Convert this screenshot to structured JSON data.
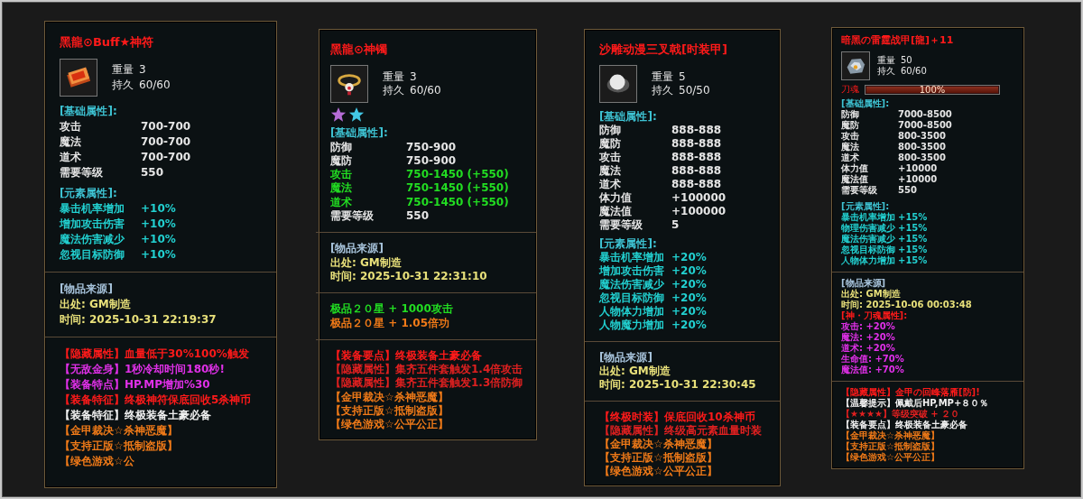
{
  "panels": [
    {
      "title": "黑龍⊙Buff★神符",
      "weight": {
        "label": "重量",
        "value": "3"
      },
      "durability": {
        "label": "持久",
        "value": "60/60"
      },
      "sections": [
        [
          {
            "kind": "heading",
            "text": "[基础属性]:",
            "color": "#3ec3d3"
          },
          {
            "kind": "stat",
            "label": "攻击",
            "value": "700-700",
            "color": "#e6e6e6"
          },
          {
            "kind": "stat",
            "label": "魔法",
            "value": "700-700",
            "color": "#e6e6e6"
          },
          {
            "kind": "stat",
            "label": "道术",
            "value": "700-700",
            "color": "#e6e6e6"
          },
          {
            "kind": "stat",
            "label": "需要等级",
            "value": "550",
            "color": "#e6e6e6"
          },
          {
            "kind": "heading",
            "text": "[元素属性]:",
            "color": "#3ec3d3"
          },
          {
            "kind": "stat",
            "label": "暴击机率增加",
            "value": "+10%",
            "color": "#22d0d0"
          },
          {
            "kind": "stat",
            "label": "增加攻击伤害",
            "value": "+10%",
            "color": "#22d0d0"
          },
          {
            "kind": "stat",
            "label": "魔法伤害减少",
            "value": "+10%",
            "color": "#22d0d0"
          },
          {
            "kind": "stat",
            "label": "忽视目标防御",
            "value": "+10%",
            "color": "#22d0d0"
          }
        ],
        [
          {
            "kind": "text",
            "text": "[物品来源]",
            "color": "#a8c4dc"
          },
          {
            "kind": "text",
            "text": "出处: GM制造",
            "color": "#e8e07a"
          },
          {
            "kind": "text",
            "text": "时间: 2025-10-31 22:19:37",
            "color": "#e8e07a"
          }
        ],
        [
          {
            "kind": "text",
            "text": "【隐藏属性】血量低于30%100%触发",
            "color": "#ff1a1a"
          },
          {
            "kind": "text",
            "text": "【无敌金身】1秒冷却时间180秒!",
            "color": "#e030e8"
          },
          {
            "kind": "text",
            "text": "【装备特点】HP.MP增加%30",
            "color": "#e030e8"
          },
          {
            "kind": "text",
            "text": "【装备特征】终极神符保底回收5杀神币",
            "color": "#ff1a1a"
          },
          {
            "kind": "text",
            "text": "【装备特征】终极装备土豪必备",
            "color": "#f0f0f0"
          },
          {
            "kind": "text",
            "text": "【金甲裁决☆杀神恶魔】",
            "color": "#f07a18"
          },
          {
            "kind": "text",
            "text": "【支持正版☆抵制盗版】",
            "color": "#f07a18"
          },
          {
            "kind": "text",
            "text": "【绿色游戏☆公",
            "color": "#f07a18"
          }
        ]
      ]
    },
    {
      "title": "黑龍⊙神镯",
      "weight": {
        "label": "重量",
        "value": "3"
      },
      "durability": {
        "label": "持久",
        "value": "60/60"
      },
      "gems": [
        {
          "color": "#b56cd6"
        },
        {
          "color": "#42c8e6"
        }
      ],
      "sections": [
        [
          {
            "kind": "heading",
            "text": "[基础属性]:",
            "color": "#3ec3d3"
          },
          {
            "kind": "stat",
            "label": "防御",
            "value": "750-900",
            "color": "#e6e6e6"
          },
          {
            "kind": "stat",
            "label": "魔防",
            "value": "750-900",
            "color": "#e6e6e6"
          },
          {
            "kind": "stat",
            "label": "攻击",
            "value": "750-1450 (+550)",
            "color": "#22dd22"
          },
          {
            "kind": "stat",
            "label": "魔法",
            "value": "750-1450 (+550)",
            "color": "#22dd22"
          },
          {
            "kind": "stat",
            "label": "道术",
            "value": "750-1450 (+550)",
            "color": "#22dd22"
          },
          {
            "kind": "stat",
            "label": "需要等级",
            "value": "550",
            "color": "#e6e6e6"
          }
        ],
        [
          {
            "kind": "text",
            "text": "[物品来源]",
            "color": "#a8c4dc"
          },
          {
            "kind": "text",
            "text": "出处: GM制造",
            "color": "#e8e07a"
          },
          {
            "kind": "text",
            "text": "时间: 2025-10-31 22:31:10",
            "color": "#e8e07a"
          }
        ],
        [
          {
            "kind": "text",
            "text": "极品２０星 + 1000攻击",
            "color": "#22dd22"
          },
          {
            "kind": "text",
            "text": "极品２０星 + 1.05倍功",
            "color": "#f07a18"
          }
        ],
        [
          {
            "kind": "text",
            "text": "【装备要点】终极装备土豪必备",
            "color": "#ff1a1a"
          },
          {
            "kind": "text",
            "text": "【隐藏属性】集齐五件套触发1.4倍攻击",
            "color": "#e02020"
          },
          {
            "kind": "text",
            "text": "【隐藏属性】集齐五件套触发1.3倍防御",
            "color": "#e02020"
          },
          {
            "kind": "text",
            "text": "【金甲裁决☆杀神恶魔】",
            "color": "#f07a18"
          },
          {
            "kind": "text",
            "text": "【支持正版☆抵制盗版】",
            "color": "#f07a18"
          },
          {
            "kind": "text",
            "text": "【绿色游戏☆公平公正】",
            "color": "#f07a18"
          }
        ]
      ]
    },
    {
      "title": "沙雕动漫三叉戟[时装甲]",
      "weight": {
        "label": "重量",
        "value": "5"
      },
      "durability": {
        "label": "持久",
        "value": "50/50"
      },
      "sections": [
        [
          {
            "kind": "heading",
            "text": "[基础属性]:",
            "color": "#3ec3d3"
          },
          {
            "kind": "stat",
            "label": "防御",
            "value": "888-888",
            "color": "#e6e6e6"
          },
          {
            "kind": "stat",
            "label": "魔防",
            "value": "888-888",
            "color": "#e6e6e6"
          },
          {
            "kind": "stat",
            "label": "攻击",
            "value": "888-888",
            "color": "#e6e6e6"
          },
          {
            "kind": "stat",
            "label": "魔法",
            "value": "888-888",
            "color": "#e6e6e6"
          },
          {
            "kind": "stat",
            "label": "道术",
            "value": "888-888",
            "color": "#e6e6e6"
          },
          {
            "kind": "stat",
            "label": "体力值",
            "value": "+100000",
            "color": "#e6e6e6"
          },
          {
            "kind": "stat",
            "label": "魔法值",
            "value": "+100000",
            "color": "#e6e6e6"
          },
          {
            "kind": "stat",
            "label": "需要等级",
            "value": "5",
            "color": "#e6e6e6"
          },
          {
            "kind": "heading",
            "text": "[元素属性]:",
            "color": "#3ec3d3"
          },
          {
            "kind": "stat",
            "label": "暴击机率增加",
            "value": "+20%",
            "color": "#22d0d0"
          },
          {
            "kind": "stat",
            "label": "增加攻击伤害",
            "value": "+20%",
            "color": "#22d0d0"
          },
          {
            "kind": "stat",
            "label": "魔法伤害减少",
            "value": "+20%",
            "color": "#22d0d0"
          },
          {
            "kind": "stat",
            "label": "忽视目标防御",
            "value": "+20%",
            "color": "#22d0d0"
          },
          {
            "kind": "stat",
            "label": "人物体力增加",
            "value": "+20%",
            "color": "#22d0d0"
          },
          {
            "kind": "stat",
            "label": "人物魔力增加",
            "value": "+20%",
            "color": "#22d0d0"
          }
        ],
        [
          {
            "kind": "text",
            "text": "[物品来源]",
            "color": "#a8c4dc"
          },
          {
            "kind": "text",
            "text": "出处: GM制造",
            "color": "#e8e07a"
          },
          {
            "kind": "text",
            "text": "时间: 2025-10-31 22:30:45",
            "color": "#e8e07a"
          }
        ],
        [
          {
            "kind": "text",
            "text": "【终极时装】保底回收10杀神币",
            "color": "#ff1a1a"
          },
          {
            "kind": "text",
            "text": "【隐藏属性】终级高元素血量时装",
            "color": "#e02020"
          },
          {
            "kind": "text",
            "text": "【金甲裁决☆杀神恶魔】",
            "color": "#f07a18"
          },
          {
            "kind": "text",
            "text": "【支持正版☆抵制盗版】",
            "color": "#f07a18"
          },
          {
            "kind": "text",
            "text": "【绿色游戏☆公平公正】",
            "color": "#f07a18"
          }
        ]
      ]
    },
    {
      "title": "暗黑の雷霆战甲[龍]＋11",
      "weight": {
        "label": "重量",
        "value": "50"
      },
      "durability": {
        "label": "持久",
        "value": "60/60"
      },
      "soul": {
        "label": "刀魂",
        "level": 1,
        "reading": "100%"
      },
      "sections": [
        [
          {
            "kind": "heading",
            "text": "[基础属性]:",
            "color": "#3ec3d3"
          },
          {
            "kind": "stat",
            "label": "防御",
            "value": "7000-8500",
            "color": "#e6e6e6"
          },
          {
            "kind": "stat",
            "label": "魔防",
            "value": "7000-8500",
            "color": "#e6e6e6"
          },
          {
            "kind": "stat",
            "label": "攻击",
            "value": "800-3500",
            "color": "#e6e6e6"
          },
          {
            "kind": "stat",
            "label": "魔法",
            "value": "800-3500",
            "color": "#e6e6e6"
          },
          {
            "kind": "stat",
            "label": "道术",
            "value": "800-3500",
            "color": "#e6e6e6"
          },
          {
            "kind": "stat",
            "label": "体力值",
            "value": "+10000",
            "color": "#e6e6e6"
          },
          {
            "kind": "stat",
            "label": "魔法值",
            "value": "+10000",
            "color": "#e6e6e6"
          },
          {
            "kind": "stat",
            "label": "需要等级",
            "value": "550",
            "color": "#e6e6e6"
          },
          {
            "kind": "heading",
            "text": "[元素属性]:",
            "color": "#3ec3d3"
          },
          {
            "kind": "stat",
            "label": "暴击机率增加",
            "value": "+15%",
            "color": "#22d0d0"
          },
          {
            "kind": "stat",
            "label": "物理伤害减少",
            "value": "+15%",
            "color": "#22d0d0"
          },
          {
            "kind": "stat",
            "label": "魔法伤害减少",
            "value": "+15%",
            "color": "#22d0d0"
          },
          {
            "kind": "stat",
            "label": "忽视目标防御",
            "value": "+15%",
            "color": "#22d0d0"
          },
          {
            "kind": "stat",
            "label": "人物体力增加",
            "value": "+15%",
            "color": "#22d0d0"
          }
        ],
        [
          {
            "kind": "text",
            "text": "[物品来源]",
            "color": "#a8c4dc"
          },
          {
            "kind": "text",
            "text": "出处: GM制造",
            "color": "#e8e07a"
          },
          {
            "kind": "text",
            "text": "时间: 2025-10-06 00:03:48",
            "color": "#e8e07a"
          },
          {
            "kind": "text",
            "text": "[神・刀魂属性]:",
            "color": "#ff1a1a"
          },
          {
            "kind": "text",
            "text": "攻击: +20%",
            "color": "#e030e8"
          },
          {
            "kind": "text",
            "text": "魔法: +20%",
            "color": "#e030e8"
          },
          {
            "kind": "text",
            "text": "道术: +20%",
            "color": "#e030e8"
          },
          {
            "kind": "text",
            "text": "生命值: +70%",
            "color": "#e030e8"
          },
          {
            "kind": "text",
            "text": "魔法值: +70%",
            "color": "#e030e8"
          }
        ],
        [
          {
            "kind": "text",
            "text": "【隐藏属性】金甲の回峰落雁[防]!",
            "color": "#ff1a1a"
          },
          {
            "kind": "text",
            "text": "【温馨提示】佩戴后HP,MP+８０％",
            "color": "#f0f0f0"
          },
          {
            "kind": "text",
            "text": "【★★★★】等级突破 + ２０",
            "color": "#e02020"
          },
          {
            "kind": "text",
            "text": "【装备要点】终极装备土豪必备",
            "color": "#f0f0f0"
          },
          {
            "kind": "text",
            "text": "【金甲裁决☆杀神恶魔】",
            "color": "#f07a18"
          },
          {
            "kind": "text",
            "text": "【支持正版☆抵制盗版】",
            "color": "#f07a18"
          },
          {
            "kind": "text",
            "text": "【绿色游戏☆公平公正】",
            "color": "#f07a18"
          }
        ]
      ]
    }
  ]
}
